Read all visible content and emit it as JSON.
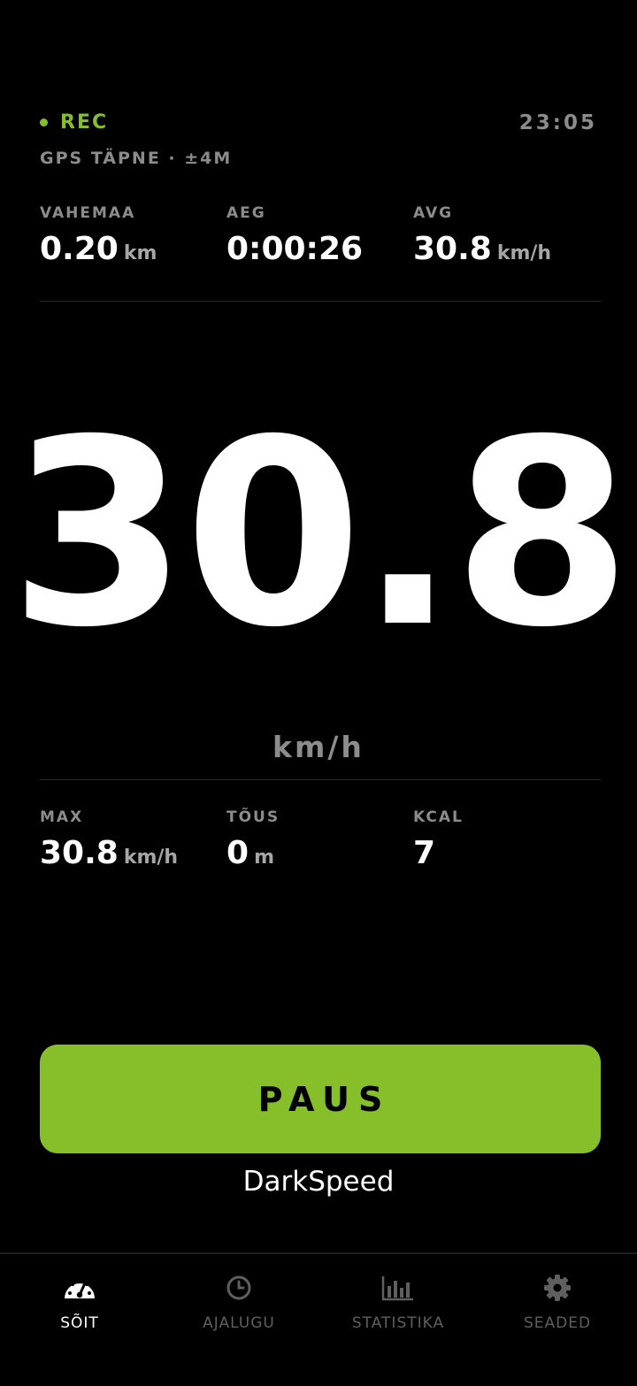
{
  "status": {
    "rec_label": "REC",
    "clock": "23:05",
    "gps_text": "GPS TÄPNE · ±4M"
  },
  "top_stats": [
    {
      "label": "VAHEMAA",
      "value": "0.20",
      "unit": "km"
    },
    {
      "label": "AEG",
      "value": "0:00:26",
      "unit": ""
    },
    {
      "label": "AVG",
      "value": "30.8",
      "unit": "km/h"
    }
  ],
  "speed": {
    "value": "30.8",
    "unit": "km/h"
  },
  "bottom_stats": [
    {
      "label": "MAX",
      "value": "30.8",
      "unit": "km/h"
    },
    {
      "label": "TÕUS",
      "value": "0",
      "unit": "m"
    },
    {
      "label": "KCAL",
      "value": "7",
      "unit": ""
    }
  ],
  "pause_label": "PAUS",
  "brand": "DarkSpeed",
  "nav": [
    {
      "label": "SÕIT",
      "icon": "speedometer-icon",
      "active": true
    },
    {
      "label": "AJALUGU",
      "icon": "clock-icon",
      "active": false
    },
    {
      "label": "STATISTIKA",
      "icon": "bar-chart-icon",
      "active": false
    },
    {
      "label": "SEADED",
      "icon": "gear-icon",
      "active": false
    }
  ],
  "colors": {
    "accent": "#86bf2a",
    "background": "#000000",
    "muted": "#8c8c8c"
  }
}
